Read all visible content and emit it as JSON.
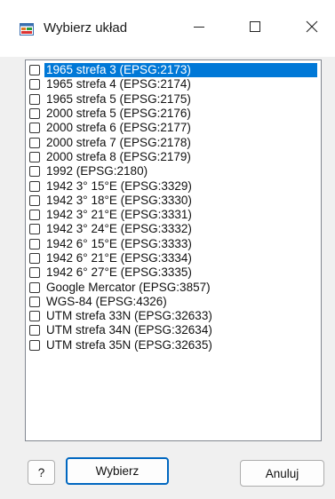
{
  "window": {
    "title": "Wybierz układ",
    "icon": "app-window-icon"
  },
  "titlebar_buttons": {
    "minimize": "minimize-icon",
    "maximize": "maximize-icon",
    "close": "close-icon"
  },
  "list": {
    "selected_index": 0,
    "items": [
      {
        "label": "1965 strefa 3 (EPSG:2173)",
        "checked": false
      },
      {
        "label": "1965 strefa 4 (EPSG:2174)",
        "checked": false
      },
      {
        "label": "1965 strefa 5 (EPSG:2175)",
        "checked": false
      },
      {
        "label": "2000 strefa 5 (EPSG:2176)",
        "checked": false
      },
      {
        "label": "2000 strefa 6 (EPSG:2177)",
        "checked": false
      },
      {
        "label": "2000 strefa 7 (EPSG:2178)",
        "checked": false
      },
      {
        "label": "2000 strefa 8 (EPSG:2179)",
        "checked": false
      },
      {
        "label": "1992 (EPSG:2180)",
        "checked": false
      },
      {
        "label": "1942 3° 15°E (EPSG:3329)",
        "checked": false
      },
      {
        "label": "1942 3° 18°E (EPSG:3330)",
        "checked": false
      },
      {
        "label": "1942 3° 21°E (EPSG:3331)",
        "checked": false
      },
      {
        "label": "1942 3° 24°E (EPSG:3332)",
        "checked": false
      },
      {
        "label": "1942 6° 15°E (EPSG:3333)",
        "checked": false
      },
      {
        "label": "1942 6° 21°E (EPSG:3334)",
        "checked": false
      },
      {
        "label": "1942 6° 27°E (EPSG:3335)",
        "checked": false
      },
      {
        "label": "Google Mercator (EPSG:3857)",
        "checked": false
      },
      {
        "label": "WGS-84 (EPSG:4326)",
        "checked": false
      },
      {
        "label": "UTM strefa 33N (EPSG:32633)",
        "checked": false
      },
      {
        "label": "UTM strefa 34N (EPSG:32634)",
        "checked": false
      },
      {
        "label": "UTM strefa 35N (EPSG:32635)",
        "checked": false
      }
    ]
  },
  "buttons": {
    "help": "?",
    "select": "Wybierz",
    "cancel": "Anuluj"
  },
  "colors": {
    "selection": "#0078d7",
    "default_button_border": "#0067c0"
  }
}
